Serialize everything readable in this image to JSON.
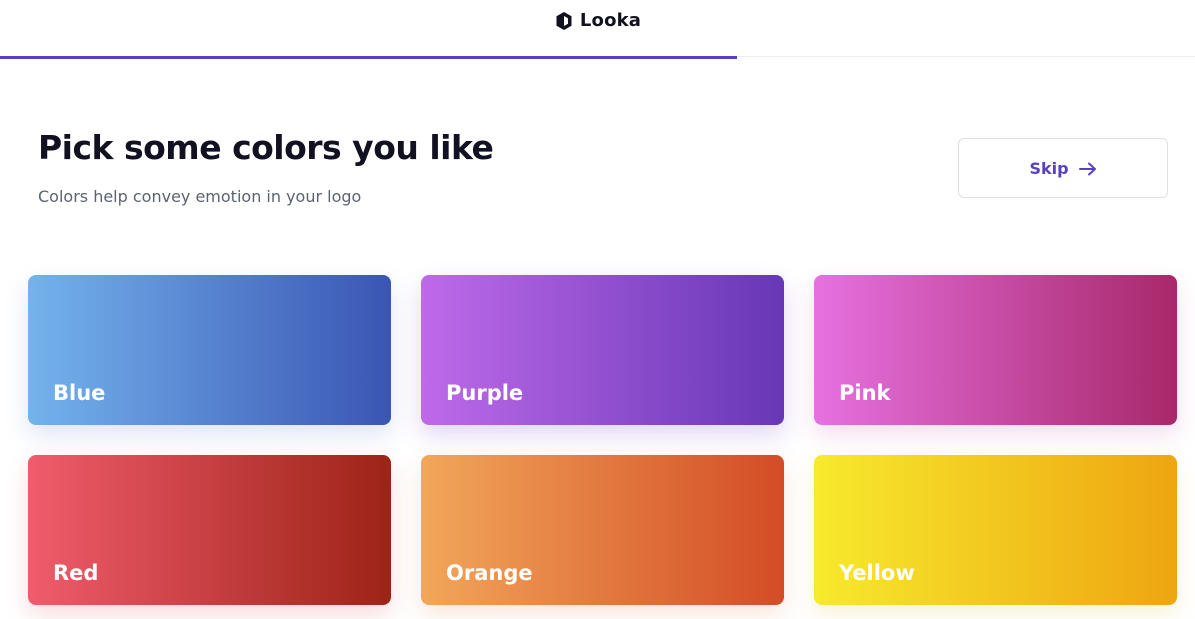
{
  "header": {
    "brand_name": "Looka",
    "brand_icon": "looka-logo-icon",
    "progress_fraction": 0.617,
    "progress_color": "#5a3fc0"
  },
  "main": {
    "title": "Pick some colors you like",
    "subtitle": "Colors help convey emotion in your logo",
    "skip": {
      "label": "Skip",
      "icon": "arrow-right-icon",
      "color": "#5a3fc0"
    },
    "colors": [
      {
        "label": "Blue",
        "gradient": [
          "#74b3ec",
          "#3a55b4"
        ]
      },
      {
        "label": "Purple",
        "gradient": [
          "#be6ae9",
          "#6637b6"
        ]
      },
      {
        "label": "Pink",
        "gradient": [
          "#e671e0",
          "#a8286a"
        ]
      },
      {
        "label": "Red",
        "gradient": [
          "#f05c6c",
          "#9d2317"
        ]
      },
      {
        "label": "Orange",
        "gradient": [
          "#f2a75a",
          "#d34c26"
        ]
      },
      {
        "label": "Yellow",
        "gradient": [
          "#f7ea2d",
          "#eea511"
        ]
      }
    ]
  }
}
